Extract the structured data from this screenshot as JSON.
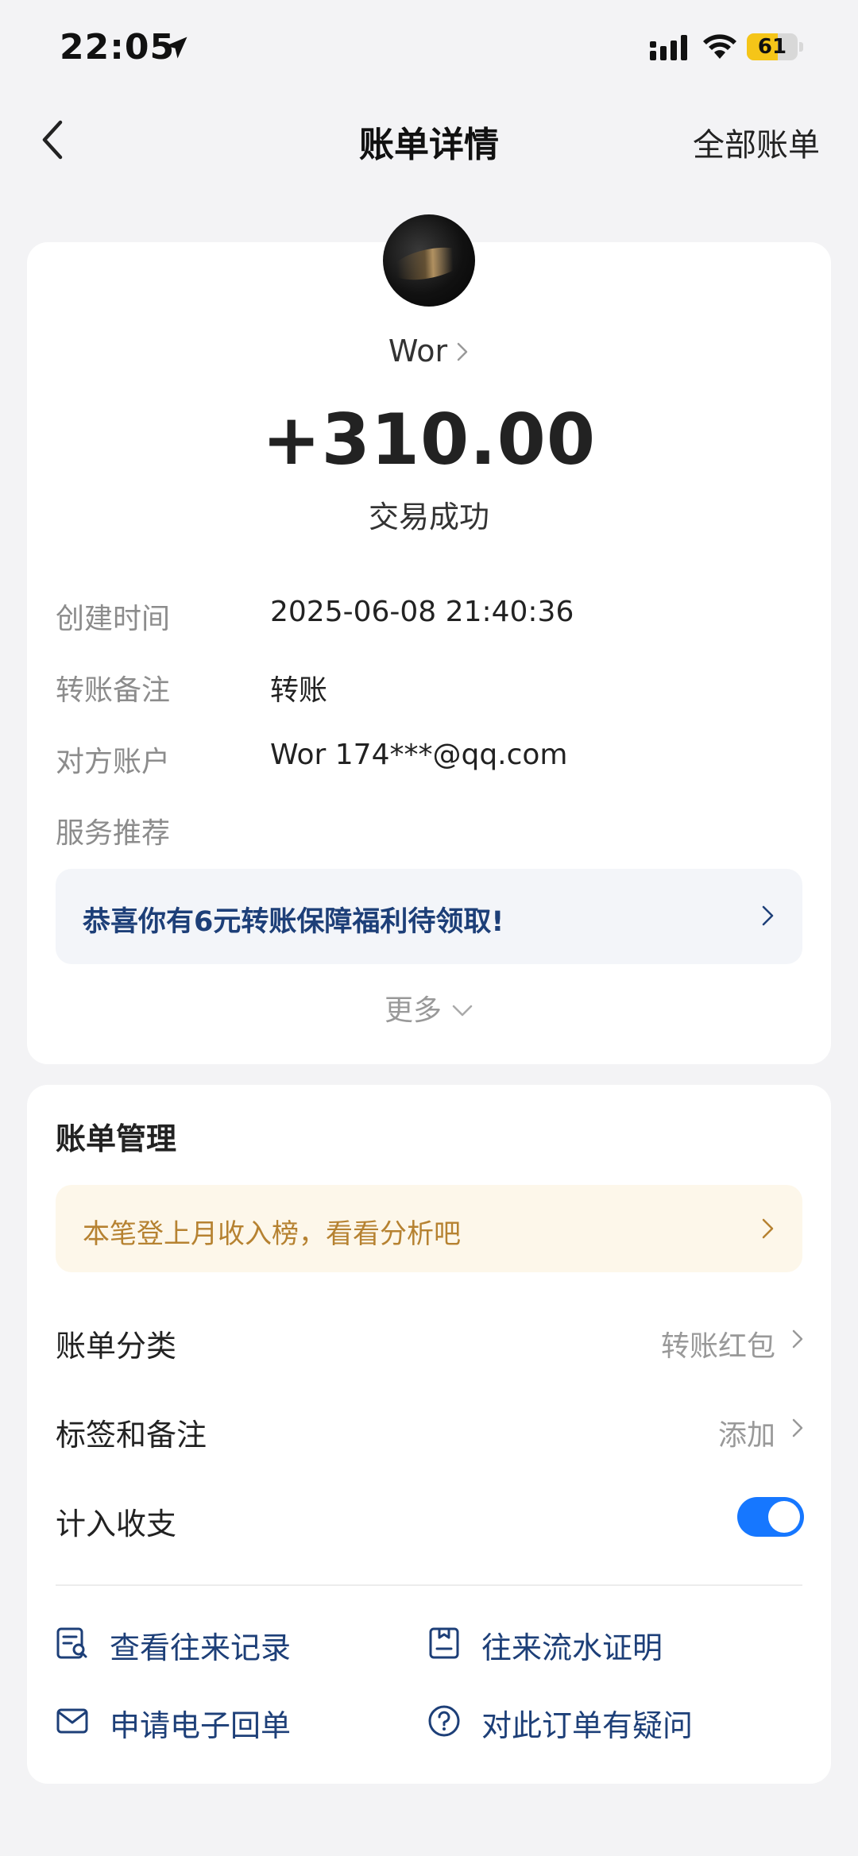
{
  "status_bar": {
    "time": "22:05",
    "battery_level": "61",
    "battery_fraction": 0.61,
    "battery_color": "#f5c518",
    "icons": [
      "location-arrow-icon",
      "cellular-signal-icon",
      "wifi-icon",
      "battery-icon"
    ]
  },
  "nav": {
    "back_icon": "chevron-left-icon",
    "title": "账单详情",
    "right_link": "全部账单"
  },
  "transaction": {
    "counterparty_name": "Wor",
    "amount": "+310.00",
    "status": "交易成功",
    "details": [
      {
        "label": "创建时间",
        "value": "2025-06-08 21:40:36"
      },
      {
        "label": "转账备注",
        "value": "转账"
      },
      {
        "label": "对方账户",
        "value": "Wor 174***@qq.com"
      },
      {
        "label": "服务推荐",
        "value": ""
      }
    ],
    "promo_text": "恭喜你有6元转账保障福利待领取!",
    "more_label": "更多"
  },
  "bill_management": {
    "title": "账单管理",
    "analysis_banner": "本笔登上月收入榜，看看分析吧",
    "rows": [
      {
        "label": "账单分类",
        "value": "转账红包"
      },
      {
        "label": "标签和备注",
        "value": "添加"
      }
    ],
    "toggle_label": "计入收支",
    "toggle_on": true,
    "actions": [
      {
        "label": "查看往来记录",
        "icon": "record-search-icon"
      },
      {
        "label": "往来流水证明",
        "icon": "statement-document-icon"
      },
      {
        "label": "申请电子回单",
        "icon": "envelope-icon"
      },
      {
        "label": "对此订单有疑问",
        "icon": "question-circle-icon"
      }
    ]
  },
  "colors": {
    "accent_blue": "#1677ff",
    "link_navy": "#1d3f78",
    "gold_text": "#b68231",
    "background": "#f3f3f5"
  }
}
